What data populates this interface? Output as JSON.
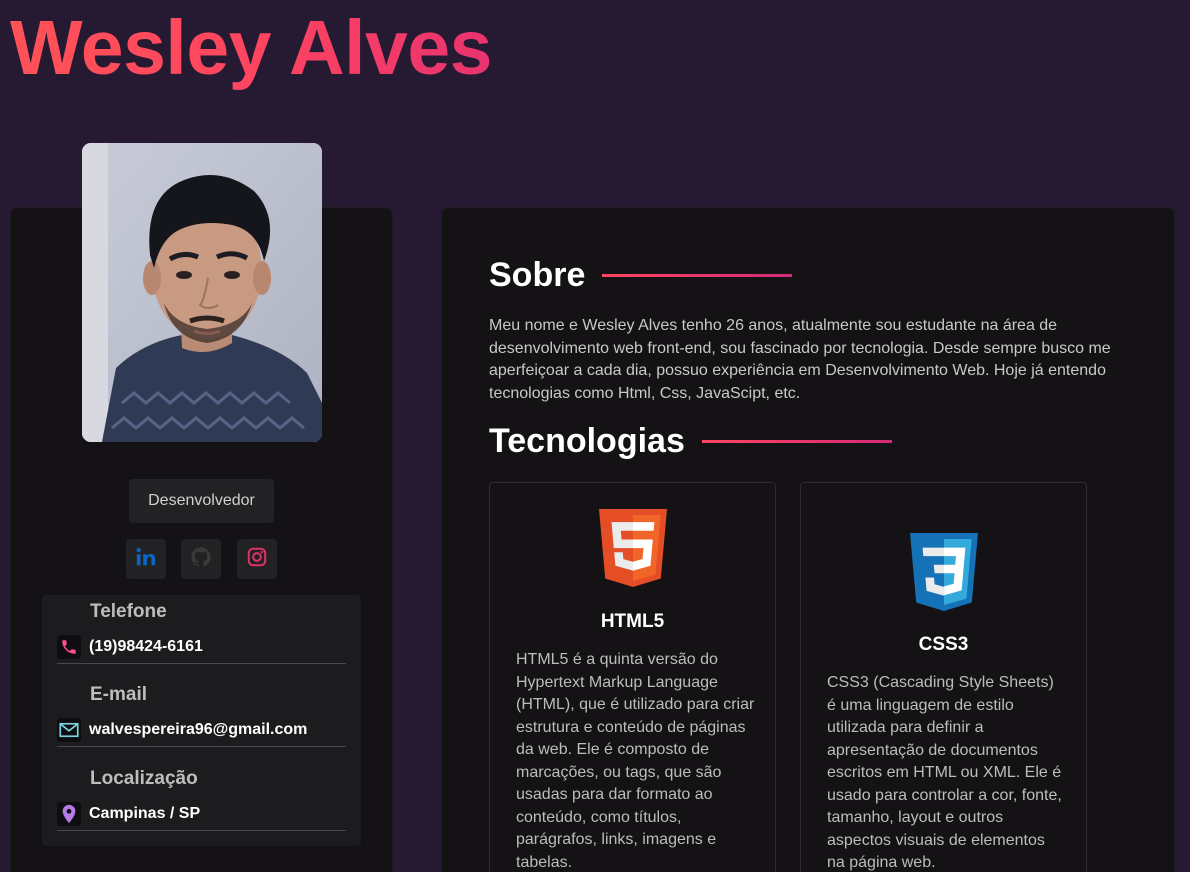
{
  "header": {
    "name": "Wesley Alves"
  },
  "profile": {
    "role_button": "Desenvolvedor",
    "social": [
      {
        "icon": "linkedin-icon",
        "color": "#0a66c2"
      },
      {
        "icon": "github-icon",
        "color": "#333333"
      },
      {
        "icon": "instagram-icon",
        "color": "#e1306c"
      }
    ]
  },
  "contact": {
    "phone_label": "Telefone",
    "phone_value": "(19)98424-6161",
    "email_label": "E-mail",
    "email_value": "walvespereira96@gmail.com",
    "location_label": "Localização",
    "location_value": "Campinas / SP"
  },
  "about": {
    "title": "Sobre",
    "text": "Meu nome e Wesley Alves tenho 26 anos, atualmente sou estudante na área de desenvolvimento web front-end, sou fascinado por tecnologia. Desde sempre busco me aperfeiçoar a cada dia, possuo experiência em Desenvolvimento Web. Hoje já entendo tecnologias como Html, Css, JavaScipt, etc."
  },
  "technologies": {
    "title": "Tecnologias",
    "items": [
      {
        "name": "HTML5",
        "icon": "html5-icon",
        "description": "HTML5 é a quinta versão do Hypertext Markup Language (HTML), que é utilizado para criar estrutura e conteúdo de páginas da web. Ele é composto de marcações, ou tags, que são usadas para dar formato ao conteúdo, como títulos, parágrafos, links, imagens e tabelas."
      },
      {
        "name": "CSS3",
        "icon": "css3-icon",
        "description": "CSS3 (Cascading Style Sheets) é uma linguagem de estilo utilizada para definir a apresentação de documentos escritos em HTML ou XML. Ele é usado para controlar a cor, fonte, tamanho, layout e outros aspectos visuais de elementos na página web."
      }
    ]
  },
  "colors": {
    "background": "#261a33",
    "card": "#141214",
    "accent": "#ff4560"
  }
}
